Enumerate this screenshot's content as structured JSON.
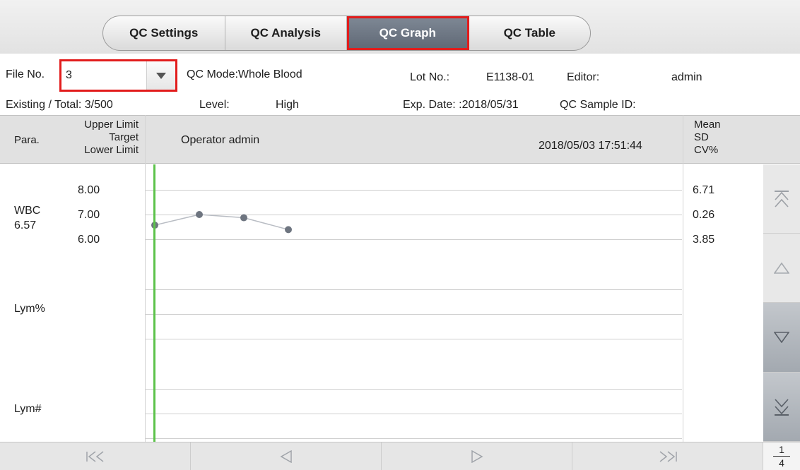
{
  "tabs": [
    {
      "label": "QC Settings"
    },
    {
      "label": "QC Analysis"
    },
    {
      "label": "QC Graph"
    },
    {
      "label": "QC Table"
    }
  ],
  "file": {
    "label": "File No.",
    "value": "3"
  },
  "qc_mode": "QC Mode:Whole Blood",
  "lot": {
    "label": "Lot No.:",
    "value": "E1138-01"
  },
  "editor": {
    "label": "Editor:",
    "value": "admin"
  },
  "existing_total": "Existing / Total: 3/500",
  "level": {
    "label": "Level:",
    "value": "High"
  },
  "exp_date": "Exp. Date: :2018/05/31",
  "qc_sample_id": {
    "label": "QC Sample ID:"
  },
  "header": {
    "para": "Para.",
    "upper_limit": "Upper Limit",
    "target": "Target",
    "lower_limit": "Lower Limit",
    "operator": "Operator  admin",
    "datetime": "2018/05/03 17:51:44",
    "mean": "Mean",
    "sd": "SD",
    "cv": "CV%"
  },
  "params": [
    {
      "name": "WBC",
      "value": "6.57",
      "upper": "8.00",
      "target": "7.00",
      "lower": "6.00",
      "mean": "6.71",
      "sd": "0.26",
      "cv": "3.85"
    },
    {
      "name": "Lym%"
    },
    {
      "name": "Lym#"
    }
  ],
  "chart_data": {
    "type": "line",
    "title": "",
    "series": [
      {
        "parameter": "WBC",
        "values": [
          6.57,
          7.0,
          6.87,
          6.39
        ]
      }
    ],
    "ylim": [
      6.0,
      8.0
    ],
    "reference_lines": {
      "upper": 8.0,
      "target": 7.0,
      "lower": 6.0
    },
    "cursor_index": 0,
    "colors": {
      "points": "#6e7580",
      "line": "#b9bdc4",
      "cursor": "#5cc24a"
    }
  },
  "pager": {
    "current": "1",
    "total": "4"
  },
  "icons": {
    "first": "first-page-icon",
    "prev": "previous-icon",
    "next": "next-icon",
    "last": "last-page-icon",
    "scroll_top": "scroll-top-icon",
    "scroll_up": "scroll-up-icon",
    "scroll_down": "scroll-down-icon",
    "scroll_bottom": "scroll-bottom-icon"
  },
  "colors": {
    "highlight": "#e21c1c",
    "active_tab": "#6b7380"
  }
}
